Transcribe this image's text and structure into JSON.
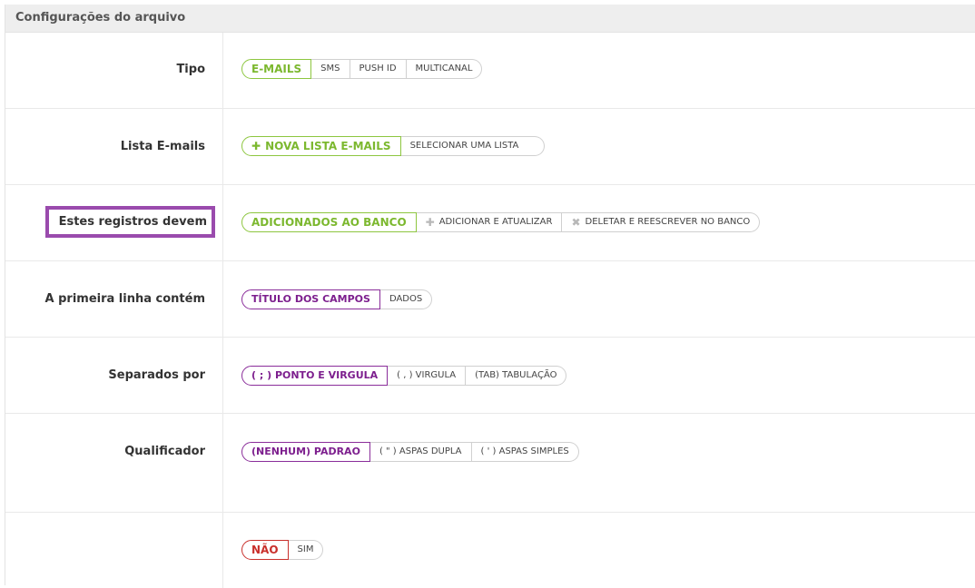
{
  "panel": {
    "title": "Configurações do arquivo"
  },
  "rows": {
    "tipo": {
      "label": "Tipo",
      "options": [
        "E-MAILS",
        "SMS",
        "PUSH ID",
        "MULTICANAL"
      ]
    },
    "lista": {
      "label": "Lista E-mails",
      "options": [
        "NOVA LISTA E-MAILS",
        "SELECIONAR UMA LISTA"
      ]
    },
    "registros": {
      "label": "Estes registros devem",
      "options": [
        "ADICIONADOS AO BANCO",
        "ADICIONAR E ATUALIZAR",
        "DELETAR E REESCREVER NO BANCO"
      ]
    },
    "primeira": {
      "label": "A primeira linha contém",
      "options": [
        "TÍTULO DOS CAMPOS",
        "DADOS"
      ]
    },
    "separados": {
      "label": "Separados por",
      "options": [
        "( ; ) PONTO E VIRGULA",
        "( , ) VIRGULA",
        "(TAB) TABULAÇÃO"
      ]
    },
    "qualificador": {
      "label": "Qualificador",
      "options": [
        "(NENHUM) PADRAO",
        "( \" ) ASPAS DUPLA",
        "( ' ) ASPAS SIMPLES"
      ]
    },
    "last": {
      "label": "",
      "options": [
        "NÃO",
        "SIM"
      ]
    }
  },
  "icons": {
    "plus": "plus-icon",
    "cross": "cross-icon"
  },
  "colors": {
    "green": "#7cb82f",
    "purple": "#7d1f8e",
    "red": "#c9302c",
    "highlight": "#9a4bad"
  }
}
